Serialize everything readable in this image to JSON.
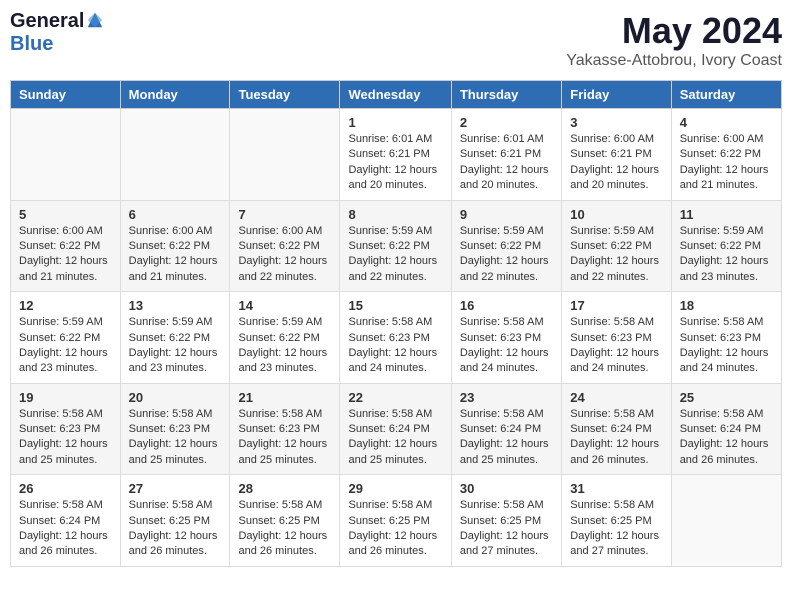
{
  "header": {
    "logo_general": "General",
    "logo_blue": "Blue",
    "month_year": "May 2024",
    "location": "Yakasse-Attobrou, Ivory Coast"
  },
  "weekdays": [
    "Sunday",
    "Monday",
    "Tuesday",
    "Wednesday",
    "Thursday",
    "Friday",
    "Saturday"
  ],
  "weeks": [
    [
      {
        "day": "",
        "sunrise": "",
        "sunset": "",
        "daylight": ""
      },
      {
        "day": "",
        "sunrise": "",
        "sunset": "",
        "daylight": ""
      },
      {
        "day": "",
        "sunrise": "",
        "sunset": "",
        "daylight": ""
      },
      {
        "day": "1",
        "sunrise": "Sunrise: 6:01 AM",
        "sunset": "Sunset: 6:21 PM",
        "daylight": "Daylight: 12 hours and 20 minutes."
      },
      {
        "day": "2",
        "sunrise": "Sunrise: 6:01 AM",
        "sunset": "Sunset: 6:21 PM",
        "daylight": "Daylight: 12 hours and 20 minutes."
      },
      {
        "day": "3",
        "sunrise": "Sunrise: 6:00 AM",
        "sunset": "Sunset: 6:21 PM",
        "daylight": "Daylight: 12 hours and 20 minutes."
      },
      {
        "day": "4",
        "sunrise": "Sunrise: 6:00 AM",
        "sunset": "Sunset: 6:22 PM",
        "daylight": "Daylight: 12 hours and 21 minutes."
      }
    ],
    [
      {
        "day": "5",
        "sunrise": "Sunrise: 6:00 AM",
        "sunset": "Sunset: 6:22 PM",
        "daylight": "Daylight: 12 hours and 21 minutes."
      },
      {
        "day": "6",
        "sunrise": "Sunrise: 6:00 AM",
        "sunset": "Sunset: 6:22 PM",
        "daylight": "Daylight: 12 hours and 21 minutes."
      },
      {
        "day": "7",
        "sunrise": "Sunrise: 6:00 AM",
        "sunset": "Sunset: 6:22 PM",
        "daylight": "Daylight: 12 hours and 22 minutes."
      },
      {
        "day": "8",
        "sunrise": "Sunrise: 5:59 AM",
        "sunset": "Sunset: 6:22 PM",
        "daylight": "Daylight: 12 hours and 22 minutes."
      },
      {
        "day": "9",
        "sunrise": "Sunrise: 5:59 AM",
        "sunset": "Sunset: 6:22 PM",
        "daylight": "Daylight: 12 hours and 22 minutes."
      },
      {
        "day": "10",
        "sunrise": "Sunrise: 5:59 AM",
        "sunset": "Sunset: 6:22 PM",
        "daylight": "Daylight: 12 hours and 22 minutes."
      },
      {
        "day": "11",
        "sunrise": "Sunrise: 5:59 AM",
        "sunset": "Sunset: 6:22 PM",
        "daylight": "Daylight: 12 hours and 23 minutes."
      }
    ],
    [
      {
        "day": "12",
        "sunrise": "Sunrise: 5:59 AM",
        "sunset": "Sunset: 6:22 PM",
        "daylight": "Daylight: 12 hours and 23 minutes."
      },
      {
        "day": "13",
        "sunrise": "Sunrise: 5:59 AM",
        "sunset": "Sunset: 6:22 PM",
        "daylight": "Daylight: 12 hours and 23 minutes."
      },
      {
        "day": "14",
        "sunrise": "Sunrise: 5:59 AM",
        "sunset": "Sunset: 6:22 PM",
        "daylight": "Daylight: 12 hours and 23 minutes."
      },
      {
        "day": "15",
        "sunrise": "Sunrise: 5:58 AM",
        "sunset": "Sunset: 6:23 PM",
        "daylight": "Daylight: 12 hours and 24 minutes."
      },
      {
        "day": "16",
        "sunrise": "Sunrise: 5:58 AM",
        "sunset": "Sunset: 6:23 PM",
        "daylight": "Daylight: 12 hours and 24 minutes."
      },
      {
        "day": "17",
        "sunrise": "Sunrise: 5:58 AM",
        "sunset": "Sunset: 6:23 PM",
        "daylight": "Daylight: 12 hours and 24 minutes."
      },
      {
        "day": "18",
        "sunrise": "Sunrise: 5:58 AM",
        "sunset": "Sunset: 6:23 PM",
        "daylight": "Daylight: 12 hours and 24 minutes."
      }
    ],
    [
      {
        "day": "19",
        "sunrise": "Sunrise: 5:58 AM",
        "sunset": "Sunset: 6:23 PM",
        "daylight": "Daylight: 12 hours and 25 minutes."
      },
      {
        "day": "20",
        "sunrise": "Sunrise: 5:58 AM",
        "sunset": "Sunset: 6:23 PM",
        "daylight": "Daylight: 12 hours and 25 minutes."
      },
      {
        "day": "21",
        "sunrise": "Sunrise: 5:58 AM",
        "sunset": "Sunset: 6:23 PM",
        "daylight": "Daylight: 12 hours and 25 minutes."
      },
      {
        "day": "22",
        "sunrise": "Sunrise: 5:58 AM",
        "sunset": "Sunset: 6:24 PM",
        "daylight": "Daylight: 12 hours and 25 minutes."
      },
      {
        "day": "23",
        "sunrise": "Sunrise: 5:58 AM",
        "sunset": "Sunset: 6:24 PM",
        "daylight": "Daylight: 12 hours and 25 minutes."
      },
      {
        "day": "24",
        "sunrise": "Sunrise: 5:58 AM",
        "sunset": "Sunset: 6:24 PM",
        "daylight": "Daylight: 12 hours and 26 minutes."
      },
      {
        "day": "25",
        "sunrise": "Sunrise: 5:58 AM",
        "sunset": "Sunset: 6:24 PM",
        "daylight": "Daylight: 12 hours and 26 minutes."
      }
    ],
    [
      {
        "day": "26",
        "sunrise": "Sunrise: 5:58 AM",
        "sunset": "Sunset: 6:24 PM",
        "daylight": "Daylight: 12 hours and 26 minutes."
      },
      {
        "day": "27",
        "sunrise": "Sunrise: 5:58 AM",
        "sunset": "Sunset: 6:25 PM",
        "daylight": "Daylight: 12 hours and 26 minutes."
      },
      {
        "day": "28",
        "sunrise": "Sunrise: 5:58 AM",
        "sunset": "Sunset: 6:25 PM",
        "daylight": "Daylight: 12 hours and 26 minutes."
      },
      {
        "day": "29",
        "sunrise": "Sunrise: 5:58 AM",
        "sunset": "Sunset: 6:25 PM",
        "daylight": "Daylight: 12 hours and 26 minutes."
      },
      {
        "day": "30",
        "sunrise": "Sunrise: 5:58 AM",
        "sunset": "Sunset: 6:25 PM",
        "daylight": "Daylight: 12 hours and 27 minutes."
      },
      {
        "day": "31",
        "sunrise": "Sunrise: 5:58 AM",
        "sunset": "Sunset: 6:25 PM",
        "daylight": "Daylight: 12 hours and 27 minutes."
      },
      {
        "day": "",
        "sunrise": "",
        "sunset": "",
        "daylight": ""
      }
    ]
  ]
}
